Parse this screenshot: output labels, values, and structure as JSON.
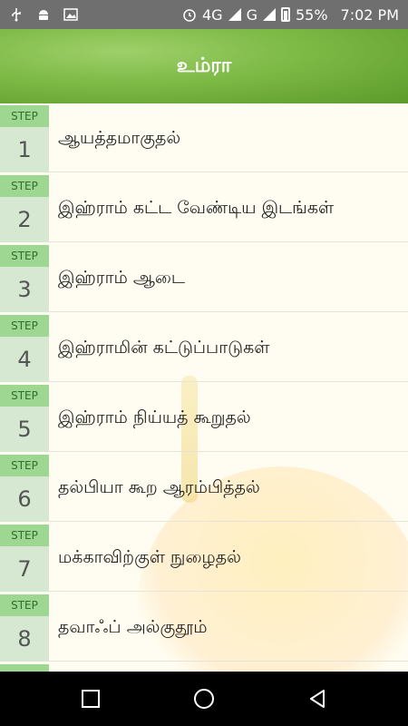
{
  "status_bar": {
    "network": "4G",
    "network2": "G",
    "battery": "55%",
    "time": "7:02 PM"
  },
  "header": {
    "title": "உம்ரா"
  },
  "steps": [
    {
      "label": "STEP",
      "number": "1",
      "text": "ஆயத்தமாகுதல்"
    },
    {
      "label": "STEP",
      "number": "2",
      "text": "இஹ்ராம் கட்ட வேண்டிய இடங்கள்"
    },
    {
      "label": "STEP",
      "number": "3",
      "text": "இஹ்ராம் ஆடை"
    },
    {
      "label": "STEP",
      "number": "4",
      "text": "இஹ்ராமின் கட்டுப்பாடுகள்"
    },
    {
      "label": "STEP",
      "number": "5",
      "text": "இஹ்ராம் நிய்யத் கூறுதல்"
    },
    {
      "label": "STEP",
      "number": "6",
      "text": "தல்பியா கூற ஆரம்பித்தல்"
    },
    {
      "label": "STEP",
      "number": "7",
      "text": "மக்காவிற்குள் நுழைதல்"
    },
    {
      "label": "STEP",
      "number": "8",
      "text": "தவாஃப் அல்குதூம்"
    }
  ],
  "nav": {
    "icons": [
      "recent-apps-icon",
      "home-icon",
      "back-icon"
    ]
  }
}
